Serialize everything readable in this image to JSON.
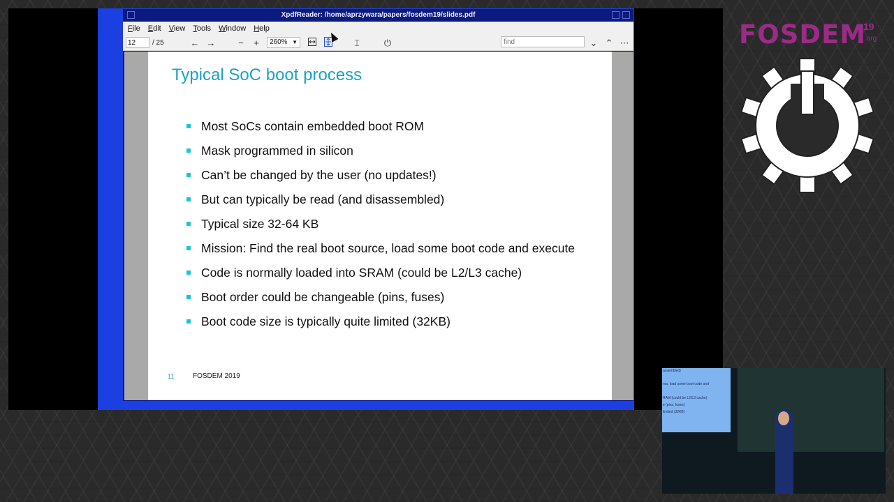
{
  "window": {
    "title": "XpdfReader: /home/aprzywara/papers/fosdem19/slides.pdf"
  },
  "menu": [
    "File",
    "Edit",
    "View",
    "Tools",
    "Window",
    "Help"
  ],
  "toolbar": {
    "page_value": "12",
    "page_count": "/ 25",
    "zoom": "260%",
    "find_placeholder": "find"
  },
  "slide": {
    "title": "Typical SoC boot process",
    "bullets": [
      "Most SoCs contain embedded boot ROM",
      "Mask programmed in silicon",
      "Can’t be changed by the user (no updates!)",
      "But can typically be read (and disassembled)",
      "Typical size 32-64 KB",
      "Mission:  Find the real boot source, load some boot code and execute",
      "Code is normally loaded into SRAM (could be L2/L3 cache)",
      "Boot order could be changeable (pins, fuses)",
      "Boot code size is typically quite limited (32KB)"
    ],
    "page_number": "11",
    "footer": "FOSDEM 2019"
  },
  "branding": {
    "name": "FOSDEM",
    "year": "19",
    "org": ".org"
  },
  "camera": {
    "screen_lines": [
      "assembled)",
      "ma, load some boot code and",
      "RAM (could be L2/L3 cache)",
      "e (pins, fuses)",
      "limited (32KB)"
    ]
  },
  "colors": {
    "accent_title": "#1ba3c2",
    "bullet": "#17c6d6",
    "brand": "#9c2b88",
    "desktop": "#1b3fe0"
  }
}
